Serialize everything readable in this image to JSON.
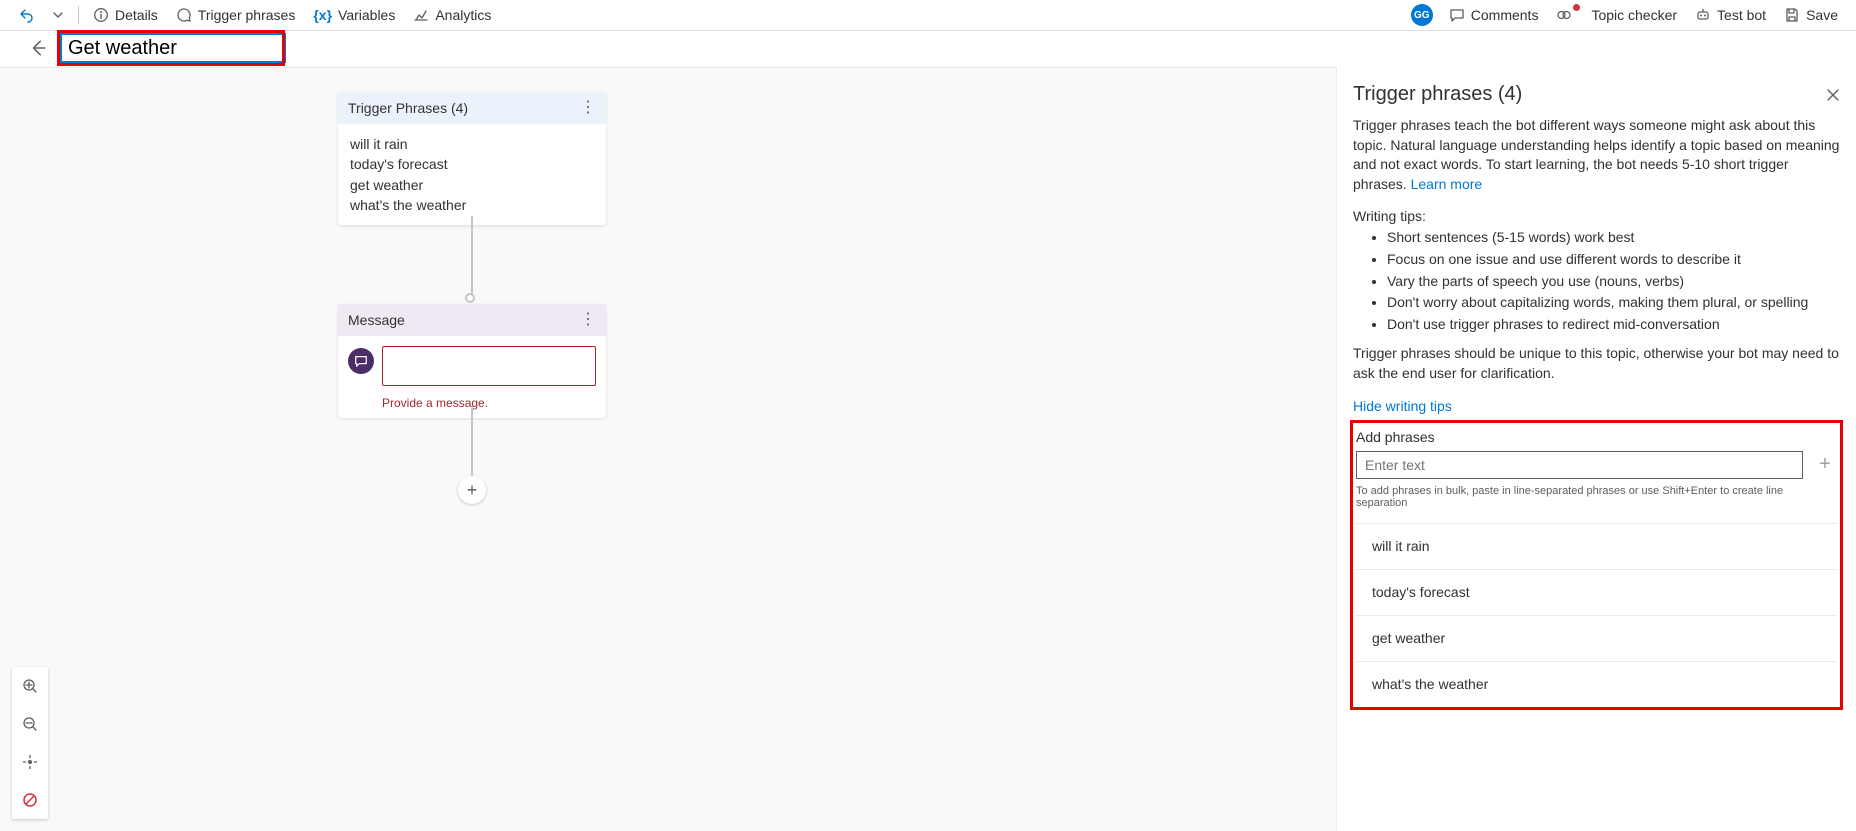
{
  "toolbar": {
    "details": "Details",
    "trigger_phrases": "Trigger phrases",
    "variables": "Variables",
    "analytics": "Analytics",
    "avatar": "GG",
    "comments": "Comments",
    "topic_checker": "Topic checker",
    "test_bot": "Test bot",
    "save": "Save"
  },
  "title": {
    "value": "Get weather"
  },
  "canvas": {
    "trigger_node": {
      "header": "Trigger Phrases (4)",
      "items": [
        "will it rain",
        "today's forecast",
        "get weather",
        "what's the weather"
      ]
    },
    "message_node": {
      "header": "Message",
      "error": "Provide a message."
    }
  },
  "panel": {
    "title": "Trigger phrases (4)",
    "description_pre": "Trigger phrases teach the bot different ways someone might ask about this topic. Natural language understanding helps identify a topic based on meaning and not exact words. To start learning, the bot needs 5-10 short trigger phrases. ",
    "learn_more": "Learn more",
    "tips_heading": "Writing tips:",
    "tips": [
      "Short sentences (5-15 words) work best",
      "Focus on one issue and use different words to describe it",
      "Vary the parts of speech you use (nouns, verbs)",
      "Don't worry about capitalizing words, making them plural, or spelling",
      "Don't use trigger phrases to redirect mid-conversation"
    ],
    "unique_note": "Trigger phrases should be unique to this topic, otherwise your bot may need to ask the end user for clarification.",
    "hide_tips": "Hide writing tips",
    "add_label": "Add phrases",
    "add_placeholder": "Enter text",
    "helper": "To add phrases in bulk, paste in line-separated phrases or use Shift+Enter to create line separation",
    "phrases": [
      "will it rain",
      "today's forecast",
      "get weather",
      "what's the weather"
    ]
  }
}
